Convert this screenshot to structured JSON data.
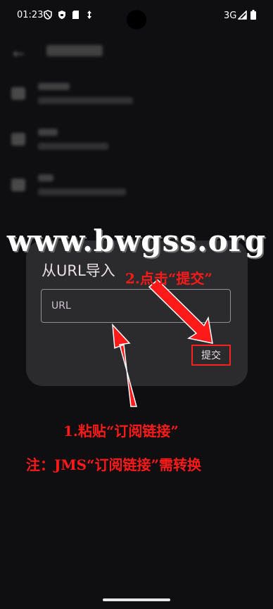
{
  "status_bar": {
    "time": "01:23",
    "network": "3G"
  },
  "watermark": "www.bwgss.org",
  "dialog": {
    "title": "从URL导入",
    "url_placeholder": "URL",
    "submit_label": "提交"
  },
  "annotations": {
    "step2": "2.点击“提交”",
    "step1": "1.粘贴“订阅链接”",
    "note": "注：JMS“订阅链接”需转换"
  },
  "colors": {
    "annotation": "#ff1a1a",
    "dialog_bg": "#2b2a2d",
    "screen_bg": "#0f0e10"
  }
}
